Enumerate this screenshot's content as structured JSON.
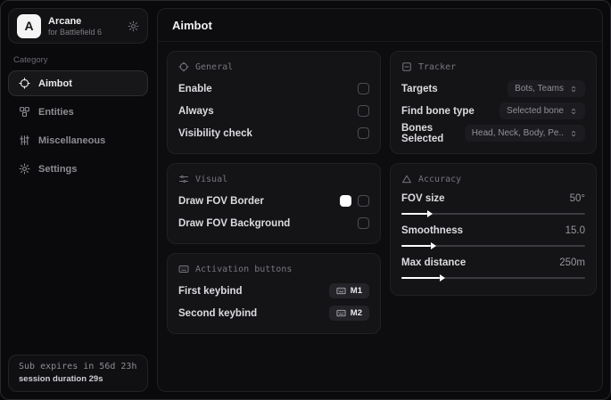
{
  "app": {
    "logo_letter": "A",
    "name": "Arcane",
    "subtitle": "for Battlefield 6"
  },
  "sidebar": {
    "category_label": "Category",
    "items": [
      {
        "label": "Aimbot",
        "icon": "crosshair-icon",
        "active": true
      },
      {
        "label": "Entities",
        "icon": "boxes-icon",
        "active": false
      },
      {
        "label": "Miscellaneous",
        "icon": "sliders-vertical-icon",
        "active": false
      },
      {
        "label": "Settings",
        "icon": "gear-icon",
        "active": false
      }
    ],
    "subscription": {
      "expires": "Sub expires in 56d 23h",
      "session": "session duration 29s"
    }
  },
  "main": {
    "title": "Aimbot",
    "general": {
      "title": "General",
      "rows": [
        {
          "label": "Enable",
          "checked": false
        },
        {
          "label": "Always",
          "checked": false
        },
        {
          "label": "Visibility check",
          "checked": false
        }
      ]
    },
    "visual": {
      "title": "Visual",
      "rows": [
        {
          "label": "Draw FOV Border",
          "swatch_color": "#ffffff",
          "checked": false
        },
        {
          "label": "Draw FOV Background",
          "checked": false
        }
      ]
    },
    "activation": {
      "title": "Activation buttons",
      "rows": [
        {
          "label": "First keybind",
          "key": "M1"
        },
        {
          "label": "Second keybind",
          "key": "M2"
        }
      ]
    },
    "tracker": {
      "title": "Tracker",
      "rows": [
        {
          "label": "Targets",
          "value": "Bots, Teams"
        },
        {
          "label": "Find bone type",
          "value": "Selected bone"
        },
        {
          "label": "Bones Selected",
          "value": "Head, Neck, Body, Pe.."
        }
      ]
    },
    "accuracy": {
      "title": "Accuracy",
      "sliders": [
        {
          "label": "FOV size",
          "value": "50°",
          "percent": 14
        },
        {
          "label": "Smoothness",
          "value": "15.0",
          "percent": 16
        },
        {
          "label": "Max distance",
          "value": "250m",
          "percent": 21
        }
      ]
    }
  },
  "colors": {
    "accent": "#ffffff",
    "fov_border_swatch": "#ffffff"
  }
}
